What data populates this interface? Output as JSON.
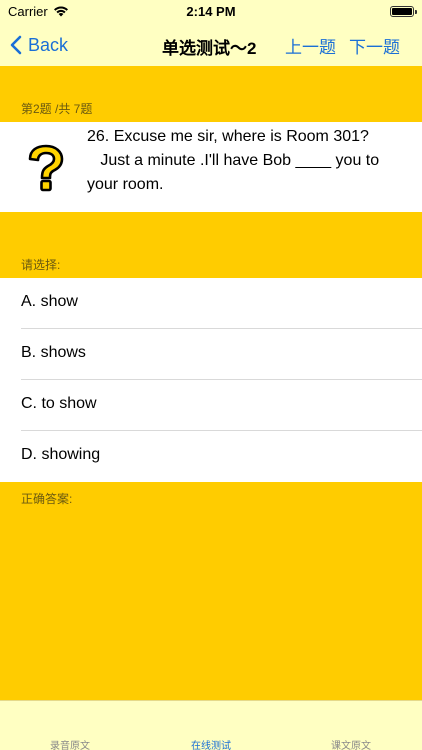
{
  "status_bar": {
    "carrier": "Carrier",
    "time": "2:14 PM"
  },
  "nav": {
    "back_label": "Back",
    "title": "单选测试～2",
    "prev_label": "上一题",
    "next_label": "下一题"
  },
  "question": {
    "progress": "第2题 /共 7题",
    "text": "26. Excuse me sir, where is Room 301?\n   Just a minute .I'll have Bob ____ you to your room."
  },
  "choose_label": "请选择:",
  "options": [
    {
      "label": "A. show"
    },
    {
      "label": "B. shows"
    },
    {
      "label": "C. to show"
    },
    {
      "label": "D. showing"
    }
  ],
  "answer_label": "正确答案:",
  "tabs": [
    {
      "label": "录音原文",
      "active": false
    },
    {
      "label": "在线测试",
      "active": true
    },
    {
      "label": "课文原文",
      "active": false
    }
  ],
  "colors": {
    "background": "#ffcc00",
    "bars": "#ffffc2",
    "accent": "#1a6fd6"
  }
}
